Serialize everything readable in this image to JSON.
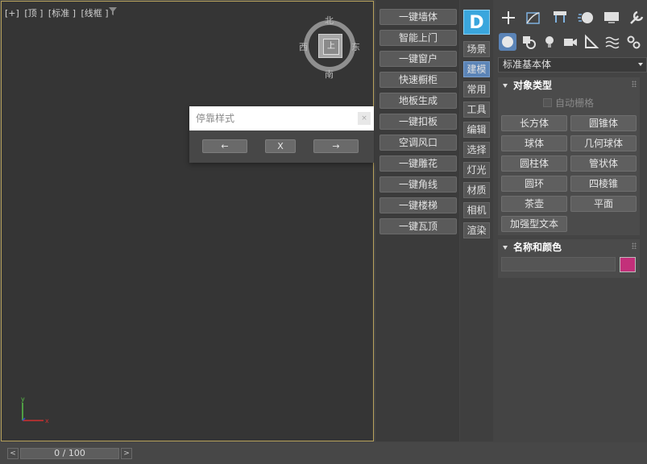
{
  "viewport": {
    "labels": [
      "[+]",
      "[顶 ]",
      "[标准 ]",
      "[线框 ]"
    ],
    "viewcube": {
      "north": "北",
      "south": "南",
      "west": "西",
      "east": "东",
      "face": "上"
    },
    "axis": {
      "y": "y",
      "x": "x"
    }
  },
  "dock_dialog": {
    "title": "停靠样式",
    "close": "×",
    "left": "←",
    "center": "X",
    "right": "→"
  },
  "tools": [
    "一键墙体",
    "智能上门",
    "一键窗户",
    "快速橱柜",
    "地板生成",
    "一键扣板",
    "空调风口",
    "一键雕花",
    "一键角线",
    "一键楼梯",
    "一键瓦顶"
  ],
  "logo": "D",
  "tabs": [
    {
      "label": "场景",
      "active": false
    },
    {
      "label": "建模",
      "active": true
    },
    {
      "label": "常用",
      "active": false
    },
    {
      "label": "工具",
      "active": false
    },
    {
      "label": "编辑",
      "active": false
    },
    {
      "label": "选择",
      "active": false
    },
    {
      "label": "灯光",
      "active": false
    },
    {
      "label": "材质",
      "active": false
    },
    {
      "label": "相机",
      "active": false
    },
    {
      "label": "渲染",
      "active": false
    }
  ],
  "command_panel": {
    "top_icons": [
      "create-icon",
      "modify-icon",
      "hierarchy-icon",
      "motion-icon",
      "display-icon",
      "utilities-icon"
    ],
    "sub_icons": [
      "geometry-icon",
      "shapes-icon",
      "lights-icon",
      "cameras-icon",
      "helpers-icon",
      "space-warps-icon",
      "systems-icon"
    ],
    "category": "标准基本体",
    "object_type": {
      "header": "对象类型",
      "auto_grid": "自动栅格",
      "buttons": [
        "长方体",
        "圆锥体",
        "球体",
        "几何球体",
        "圆柱体",
        "管状体",
        "圆环",
        "四棱锥",
        "茶壶",
        "平面",
        "加强型文本"
      ]
    },
    "name_color": {
      "header": "名称和颜色",
      "name_value": "",
      "color": "#c3307a"
    }
  },
  "time_slider": {
    "prev": "<",
    "next": ">",
    "text": "0 / 100"
  }
}
